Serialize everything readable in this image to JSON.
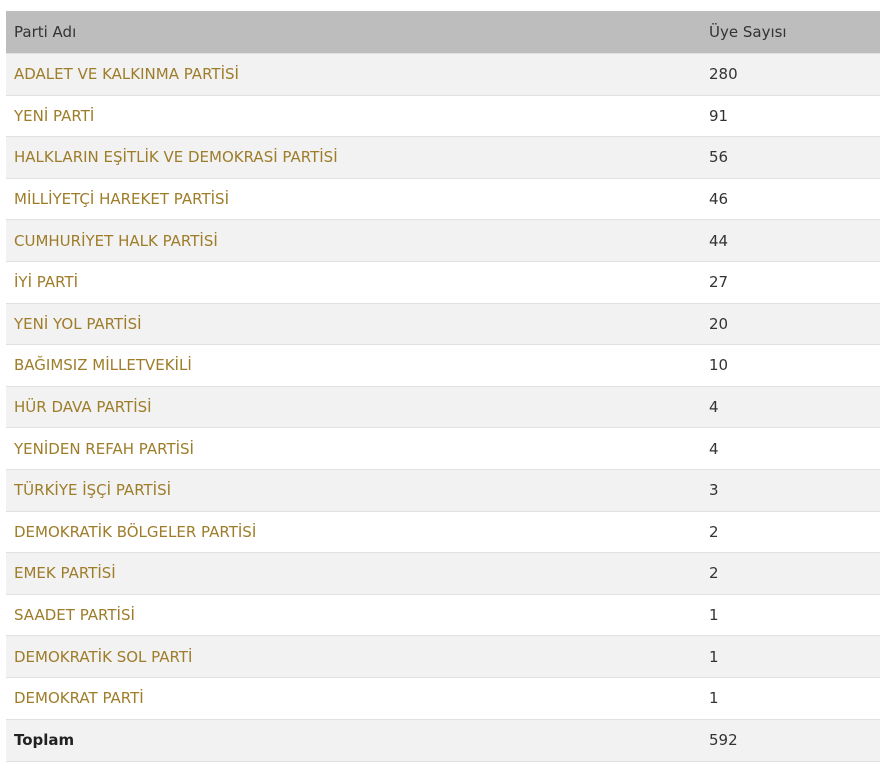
{
  "table": {
    "headers": {
      "party": "Parti Adı",
      "members": "Üye Sayısı"
    },
    "rows": [
      {
        "party": "ADALET VE KALKINMA PARTİSİ",
        "members": "280"
      },
      {
        "party": "YENİ PARTİ",
        "members": "91"
      },
      {
        "party": "HALKLARIN EŞİTLİK VE DEMOKRASİ PARTİSİ",
        "members": "56"
      },
      {
        "party": "MİLLİYETÇİ HAREKET PARTİSİ",
        "members": "46"
      },
      {
        "party": "CUMHURİYET HALK PARTİSİ",
        "members": "44"
      },
      {
        "party": "İYİ PARTİ",
        "members": "27"
      },
      {
        "party": "YENİ YOL PARTİSİ",
        "members": "20"
      },
      {
        "party": "BAĞIMSIZ MİLLETVEKİLİ",
        "members": "10"
      },
      {
        "party": "HÜR DAVA PARTİSİ",
        "members": "4"
      },
      {
        "party": "YENİDEN REFAH PARTİSİ",
        "members": "4"
      },
      {
        "party": "TÜRKİYE İŞÇİ PARTİSİ",
        "members": "3"
      },
      {
        "party": "DEMOKRATİK BÖLGELER PARTİSİ",
        "members": "2"
      },
      {
        "party": "EMEK PARTİSİ",
        "members": "2"
      },
      {
        "party": "SAADET PARTİSİ",
        "members": "1"
      },
      {
        "party": "DEMOKRATİK SOL PARTİ",
        "members": "1"
      },
      {
        "party": "DEMOKRAT PARTİ",
        "members": "1"
      }
    ],
    "total": {
      "label": "Toplam",
      "members": "592"
    }
  },
  "colors": {
    "header_bg": "#bdbdbd",
    "party_link": "#9e7d2a",
    "row_stripe": "#f2f2f2"
  }
}
